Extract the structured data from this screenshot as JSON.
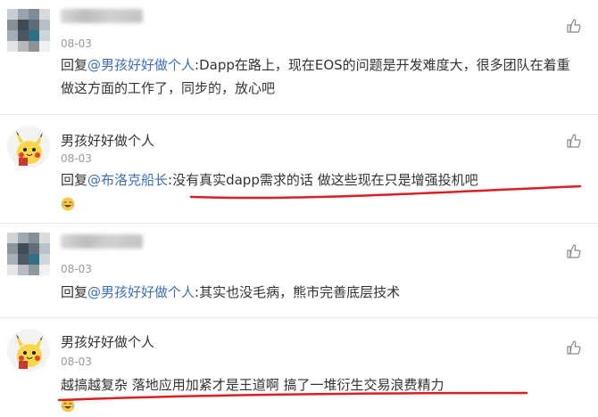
{
  "comments": [
    {
      "name": "",
      "date": "08-03",
      "reply_prefix": "回复",
      "mention": "@男孩好好做个人",
      "content": ":Dapp在路上，现在EOS的问题是开发难度大，很多团队在着重做这方面的工作了，同步的，放心吧",
      "avatar": "mosaic"
    },
    {
      "name": "男孩好好做个人",
      "date": "08-03",
      "reply_prefix": "回复",
      "mention": "@布洛克船长",
      "content": ":没有真实dapp需求的话 做这些现在只是增强投机吧",
      "avatar": "pikachu",
      "emoji": "laugh-emoji"
    },
    {
      "name": "",
      "date": "08-03",
      "reply_prefix": "回复",
      "mention": "@男孩好好做个人",
      "content": ":其实也没毛病，熊市完善底层技术",
      "avatar": "mosaic"
    },
    {
      "name": "男孩好好做个人",
      "date": "08-03",
      "reply_prefix": "",
      "mention": "",
      "content": "越搞越复杂 落地应用加紧才是王道啊 搞了一堆衍生交易浪费精力",
      "avatar": "pikachu",
      "emoji": "laugh-emoji"
    }
  ],
  "colors": {
    "mention": "#3c6fb4",
    "underline": "#d91f1f",
    "divider": "#e5e5e5"
  },
  "icons": {
    "like": "thumbs-up-icon"
  }
}
